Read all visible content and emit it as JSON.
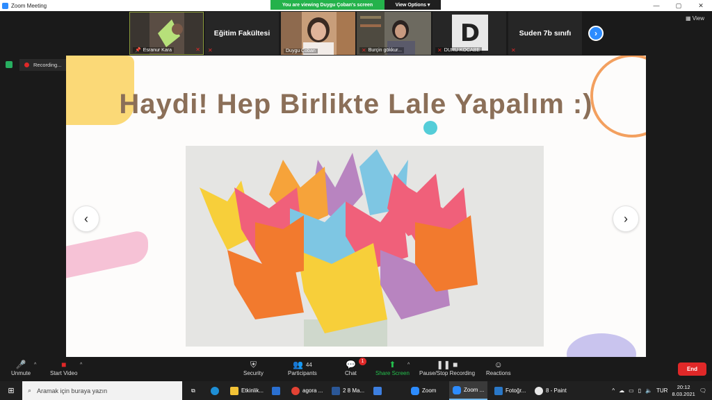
{
  "window": {
    "title": "Zoom Meeting",
    "controls": [
      "—",
      "▢",
      "✕"
    ]
  },
  "share_banner": {
    "message": "You are viewing Duygu Çoban's screen",
    "options_label": "View Options ▾"
  },
  "participants": [
    {
      "name": "Esranur Kara",
      "type": "video",
      "pinned": true,
      "mic_muted": true
    },
    {
      "name": "Eğitim Fakültesi",
      "type": "name-only",
      "mic_muted": true
    },
    {
      "name": "Duygu Çoban",
      "type": "video",
      "mic_muted": false
    },
    {
      "name": "Burçin gökkur...",
      "type": "video",
      "mic_muted": true
    },
    {
      "name": "DURU KOCABE",
      "type": "video",
      "mic_muted": true
    },
    {
      "name": "Suden 7b sınıfı",
      "type": "name-only",
      "mic_muted": true
    }
  ],
  "view_label": "View",
  "recording": {
    "label": "Recording..."
  },
  "slide": {
    "title": "Haydi! Hep Birlikte Lale Yapalım :)",
    "image_desc_colors": [
      "#f6a33a",
      "#f0607a",
      "#7ec6e3",
      "#f7cf3a",
      "#b884c0",
      "#f27a2e"
    ]
  },
  "controls": {
    "unmute": "Unmute",
    "start_video": "Start Video",
    "security": "Security",
    "participants": "Participants",
    "participants_count": "44",
    "chat": "Chat",
    "chat_badge": "1",
    "share_screen": "Share Screen",
    "recording": "Pause/Stop Recording",
    "reactions": "Reactions",
    "end": "End"
  },
  "taskbar": {
    "search_placeholder": "Aramak için buraya yazın",
    "items": [
      "Etkinlik...",
      "agora ...",
      "2 8 Ma...",
      "Zoom",
      "Zoom ...",
      "Fotoğr...",
      "8 - Paint"
    ],
    "language": "TUR",
    "time": "20:12",
    "date": "8.03.2021"
  }
}
